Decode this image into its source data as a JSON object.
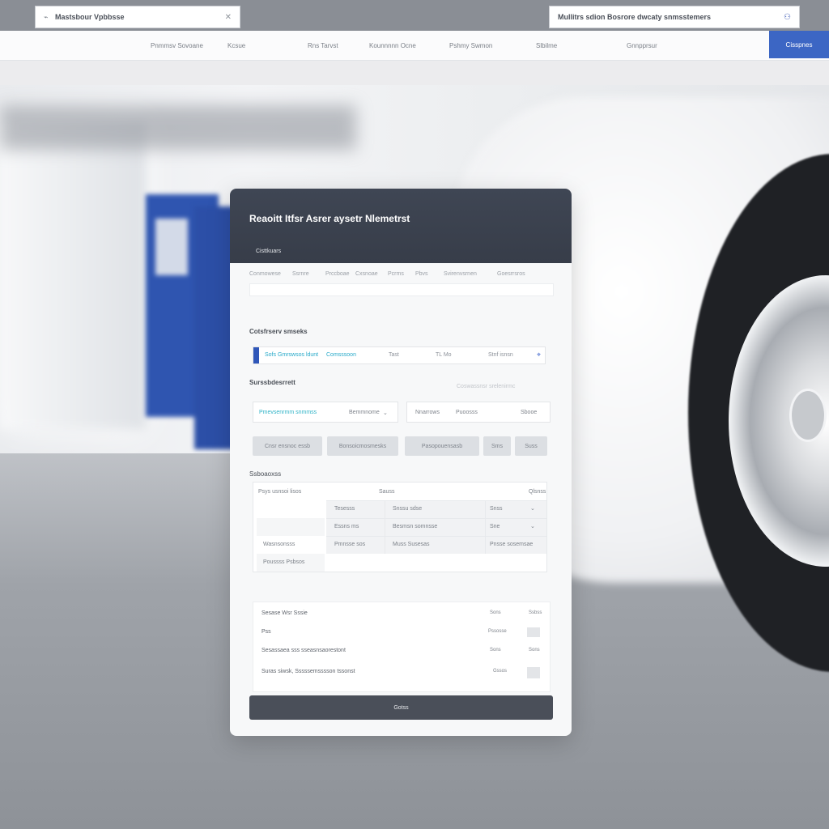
{
  "browser": {
    "left_field": {
      "icon": "location-icon",
      "text": "Mastsbour Vpbbsse",
      "trailing_icon": "close-icon"
    },
    "right_field": {
      "text": "Mullitrs sdion Bosrore dwcaty snmsstemers",
      "trailing_icon": "user-icon"
    }
  },
  "nav": {
    "items": [
      "Pnmmsv Sovoane",
      "Kcsue",
      "Rns Tarvst",
      "Kounnnnn Ocne",
      "Pshmy Swmon",
      "Slbilme",
      "Gnnpprsur"
    ],
    "cta": "Cisspnes"
  },
  "card": {
    "title": "Reaoitt Itfsr Asrer aysetr Nlemetrst",
    "header_tab": "Cisttkuars",
    "tabs": [
      "Conmowese",
      "Ssrnre",
      "Prccboae",
      "Cxsnoae",
      "Pcrms",
      "Pbvs",
      "Svirenvsrnen",
      "Goesrrsros"
    ],
    "section1_label": "Cotsfrserv smseks",
    "search": {
      "field1": "Sofs Gmrswsos ldunt",
      "field2": "Comsssoon",
      "field3": "Tast",
      "field4": "TL Mo",
      "field5": "Stnf isnsn",
      "icon": "pin-icon"
    },
    "section2_label": "Surssbdesrrett",
    "hint": "Coswassnsr srelenirmc",
    "inputs": [
      {
        "label": "Pmevsenrmm snmmss",
        "value": "Bemmnome",
        "suffix": "⌄"
      },
      {
        "label": "Nnarrows",
        "value": "Puoosss",
        "suffix": "Sbooe"
      }
    ],
    "chips": [
      "Cnsr ensnoc essb",
      "Bonsoicmosmesks",
      "Pasopouensasb",
      "Sms",
      "Suss"
    ],
    "section3_label": "Ssboaoxss",
    "table": {
      "head": [
        "Psys usnsoi lisos",
        "Sauss",
        "Qlsnss"
      ],
      "rows": [
        [
          "",
          "Tesesss",
          "Snssu sdse",
          "Snss",
          "⌄"
        ],
        [
          "",
          "Essns ms",
          "Besmsn somnsse",
          "Sne",
          "⌄"
        ],
        [
          "Wasnsonsss",
          "Pmnsse sos",
          "Muss Susesas",
          "Pnsse sosemsae",
          ""
        ]
      ],
      "footer_cell": "Poussss Psbsos"
    },
    "summary": [
      {
        "label": "Sesase Wsr Sssie",
        "v1": "Sons",
        "v2": "Ssbss"
      },
      {
        "label": "Pss",
        "v1": "Pssosse",
        "v2": ""
      },
      {
        "label": "Sesassaea sss sseasnsaorestont",
        "v1": "Sons",
        "v2": "Sons"
      },
      {
        "label": "Suras siwsk, Sssssemsssson tssonst",
        "v1": "Gssos",
        "v2": ""
      }
    ],
    "primary_button": "Gotss"
  },
  "colors": {
    "accent": "#3c66c4",
    "header": "#3c4350",
    "button": "#4a4f59",
    "cyan": "#2fb3c7"
  }
}
